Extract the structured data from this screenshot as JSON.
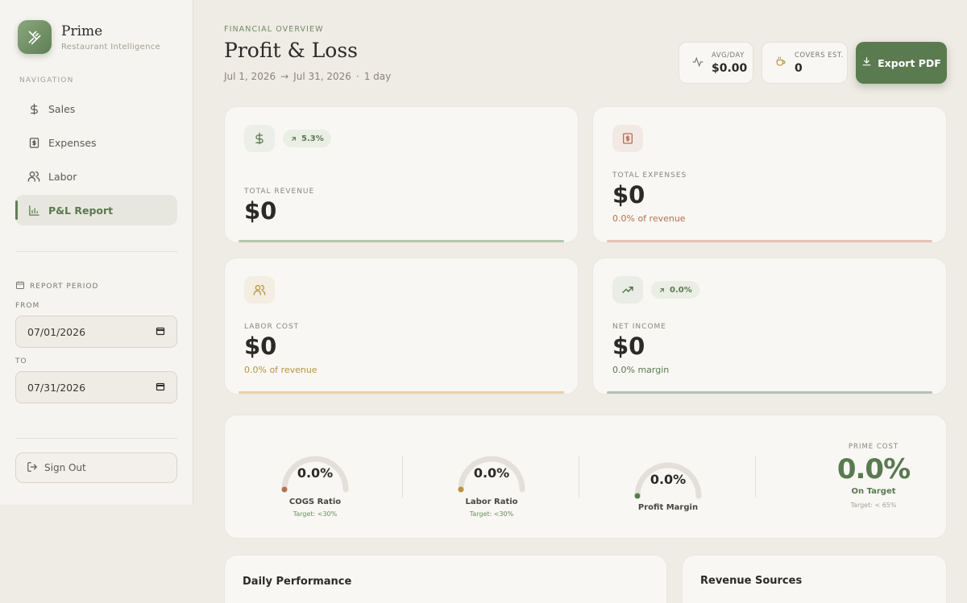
{
  "brand": {
    "name": "Prime",
    "subtitle": "Restaurant Intelligence"
  },
  "nav": {
    "label": "NAVIGATION",
    "items": [
      {
        "label": "Sales",
        "icon": "dollar-icon"
      },
      {
        "label": "Expenses",
        "icon": "receipt-icon"
      },
      {
        "label": "Labor",
        "icon": "users-icon"
      },
      {
        "label": "P&L Report",
        "icon": "bar-chart-icon",
        "active": true
      }
    ]
  },
  "period": {
    "label": "REPORT PERIOD",
    "from_label": "FROM",
    "from_value": "07/01/2026",
    "to_label": "TO",
    "to_value": "07/31/2026"
  },
  "signout": {
    "label": "Sign Out"
  },
  "header": {
    "eyebrow": "FINANCIAL OVERVIEW",
    "title": "Profit & Loss",
    "range_start": "Jul 1, 2026",
    "range_arrow": "→",
    "range_end": "Jul 31, 2026",
    "range_sep": "·",
    "range_days": "1 day"
  },
  "stats": {
    "avg_label": "AVG/DAY",
    "avg_value": "$0.00",
    "covers_label": "COVERS EST.",
    "covers_value": "0",
    "export_label": "Export PDF"
  },
  "cards": {
    "revenue": {
      "label": "TOTAL REVENUE",
      "value": "$0",
      "badge": "5.3%"
    },
    "expenses": {
      "label": "TOTAL EXPENSES",
      "value": "$0",
      "sub": "0.0% of revenue"
    },
    "labor": {
      "label": "LABOR COST",
      "value": "$0",
      "sub": "0.0% of revenue"
    },
    "net": {
      "label": "NET INCOME",
      "value": "$0",
      "sub": "0.0% margin",
      "badge": "0.0%"
    }
  },
  "gauges": [
    {
      "name": "COGS Ratio",
      "value": "0.0%",
      "target": "Target: <30%",
      "fraction": 0.0
    },
    {
      "name": "Labor Ratio",
      "value": "0.0%",
      "target": "Target: <30%",
      "fraction": 0.0
    },
    {
      "name": "Profit Margin",
      "value": "0.0%",
      "fraction": 0.0
    }
  ],
  "prime_cost": {
    "label": "PRIME COST",
    "value": "0.0%",
    "status": "On Target",
    "target": "Target: < 65%"
  },
  "sections": {
    "daily": "Daily Performance",
    "sources": "Revenue Sources"
  },
  "colors": {
    "accent": "#5a7a50",
    "expense": "#b86f52",
    "labor": "#b8943f",
    "revenue_bar": "#b5c6ad",
    "expense_bar": "#e6c3b8",
    "labor_bar": "#e6d2ae",
    "net_bar": "#b3c2b3"
  }
}
